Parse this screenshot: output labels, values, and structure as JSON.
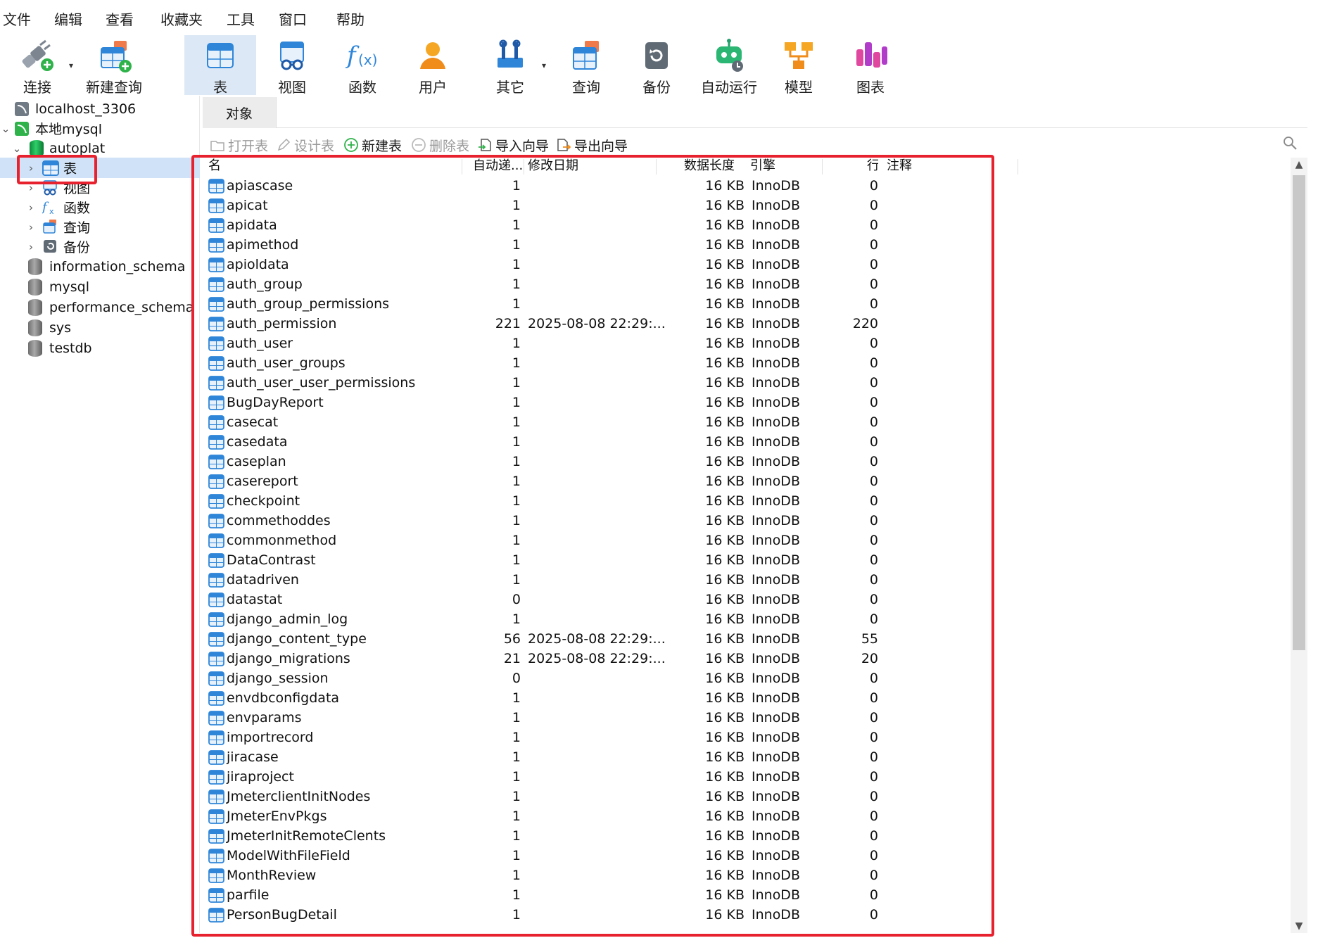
{
  "menu": [
    "文件",
    "编辑",
    "查看",
    "收藏夹",
    "工具",
    "窗口",
    "帮助"
  ],
  "toolbar": {
    "connect": "连接",
    "new_query": "新建查询",
    "table": "表",
    "view": "视图",
    "function": "函数",
    "user": "用户",
    "other": "其它",
    "query": "查询",
    "backup": "备份",
    "auto_run": "自动运行",
    "model": "模型",
    "chart": "图表",
    "dropdown_glyph": "▾"
  },
  "tree": {
    "connection": "localhost_3306",
    "local_mysql": "本地mysql",
    "db_autoplat": "autoplat",
    "node_table": "表",
    "node_view": "视图",
    "node_function": "函数",
    "node_query": "查询",
    "node_backup": "备份",
    "db_information_schema": "information_schema",
    "db_mysql": "mysql",
    "db_performance_schema": "performance_schema",
    "db_sys": "sys",
    "db_testdb": "testdb"
  },
  "objects_tab": "对象",
  "object_toolbar": {
    "open_table": "打开表",
    "design_table": "设计表",
    "new_table": "新建表",
    "delete_table": "删除表",
    "import_wizard": "导入向导",
    "export_wizard": "导出向导"
  },
  "columns": {
    "name": "名",
    "auto_increment": "自动递...",
    "modified": "修改日期",
    "data_length": "数据长度",
    "engine": "引擎",
    "rows": "行",
    "comment": "注释"
  },
  "rows": [
    {
      "name": "apiascase",
      "auto": "1",
      "modified": "",
      "size": "16 KB",
      "engine": "InnoDB",
      "rows": "0"
    },
    {
      "name": "apicat",
      "auto": "1",
      "modified": "",
      "size": "16 KB",
      "engine": "InnoDB",
      "rows": "0"
    },
    {
      "name": "apidata",
      "auto": "1",
      "modified": "",
      "size": "16 KB",
      "engine": "InnoDB",
      "rows": "0"
    },
    {
      "name": "apimethod",
      "auto": "1",
      "modified": "",
      "size": "16 KB",
      "engine": "InnoDB",
      "rows": "0"
    },
    {
      "name": "apioldata",
      "auto": "1",
      "modified": "",
      "size": "16 KB",
      "engine": "InnoDB",
      "rows": "0"
    },
    {
      "name": "auth_group",
      "auto": "1",
      "modified": "",
      "size": "16 KB",
      "engine": "InnoDB",
      "rows": "0"
    },
    {
      "name": "auth_group_permissions",
      "auto": "1",
      "modified": "",
      "size": "16 KB",
      "engine": "InnoDB",
      "rows": "0"
    },
    {
      "name": "auth_permission",
      "auto": "221",
      "modified": "2025-08-08 22:29:...",
      "size": "16 KB",
      "engine": "InnoDB",
      "rows": "220"
    },
    {
      "name": "auth_user",
      "auto": "1",
      "modified": "",
      "size": "16 KB",
      "engine": "InnoDB",
      "rows": "0"
    },
    {
      "name": "auth_user_groups",
      "auto": "1",
      "modified": "",
      "size": "16 KB",
      "engine": "InnoDB",
      "rows": "0"
    },
    {
      "name": "auth_user_user_permissions",
      "auto": "1",
      "modified": "",
      "size": "16 KB",
      "engine": "InnoDB",
      "rows": "0"
    },
    {
      "name": "BugDayReport",
      "auto": "1",
      "modified": "",
      "size": "16 KB",
      "engine": "InnoDB",
      "rows": "0"
    },
    {
      "name": "casecat",
      "auto": "1",
      "modified": "",
      "size": "16 KB",
      "engine": "InnoDB",
      "rows": "0"
    },
    {
      "name": "casedata",
      "auto": "1",
      "modified": "",
      "size": "16 KB",
      "engine": "InnoDB",
      "rows": "0"
    },
    {
      "name": "caseplan",
      "auto": "1",
      "modified": "",
      "size": "16 KB",
      "engine": "InnoDB",
      "rows": "0"
    },
    {
      "name": "casereport",
      "auto": "1",
      "modified": "",
      "size": "16 KB",
      "engine": "InnoDB",
      "rows": "0"
    },
    {
      "name": "checkpoint",
      "auto": "1",
      "modified": "",
      "size": "16 KB",
      "engine": "InnoDB",
      "rows": "0"
    },
    {
      "name": "commethoddes",
      "auto": "1",
      "modified": "",
      "size": "16 KB",
      "engine": "InnoDB",
      "rows": "0"
    },
    {
      "name": "commonmethod",
      "auto": "1",
      "modified": "",
      "size": "16 KB",
      "engine": "InnoDB",
      "rows": "0"
    },
    {
      "name": "DataContrast",
      "auto": "1",
      "modified": "",
      "size": "16 KB",
      "engine": "InnoDB",
      "rows": "0"
    },
    {
      "name": "datadriven",
      "auto": "1",
      "modified": "",
      "size": "16 KB",
      "engine": "InnoDB",
      "rows": "0"
    },
    {
      "name": "datastat",
      "auto": "0",
      "modified": "",
      "size": "16 KB",
      "engine": "InnoDB",
      "rows": "0"
    },
    {
      "name": "django_admin_log",
      "auto": "1",
      "modified": "",
      "size": "16 KB",
      "engine": "InnoDB",
      "rows": "0"
    },
    {
      "name": "django_content_type",
      "auto": "56",
      "modified": "2025-08-08 22:29:...",
      "size": "16 KB",
      "engine": "InnoDB",
      "rows": "55"
    },
    {
      "name": "django_migrations",
      "auto": "21",
      "modified": "2025-08-08 22:29:...",
      "size": "16 KB",
      "engine": "InnoDB",
      "rows": "20"
    },
    {
      "name": "django_session",
      "auto": "0",
      "modified": "",
      "size": "16 KB",
      "engine": "InnoDB",
      "rows": "0"
    },
    {
      "name": "envdbconfigdata",
      "auto": "1",
      "modified": "",
      "size": "16 KB",
      "engine": "InnoDB",
      "rows": "0"
    },
    {
      "name": "envparams",
      "auto": "1",
      "modified": "",
      "size": "16 KB",
      "engine": "InnoDB",
      "rows": "0"
    },
    {
      "name": "importrecord",
      "auto": "1",
      "modified": "",
      "size": "16 KB",
      "engine": "InnoDB",
      "rows": "0"
    },
    {
      "name": "jiracase",
      "auto": "1",
      "modified": "",
      "size": "16 KB",
      "engine": "InnoDB",
      "rows": "0"
    },
    {
      "name": "jiraproject",
      "auto": "1",
      "modified": "",
      "size": "16 KB",
      "engine": "InnoDB",
      "rows": "0"
    },
    {
      "name": "JmeterclientInitNodes",
      "auto": "1",
      "modified": "",
      "size": "16 KB",
      "engine": "InnoDB",
      "rows": "0"
    },
    {
      "name": "JmeterEnvPkgs",
      "auto": "1",
      "modified": "",
      "size": "16 KB",
      "engine": "InnoDB",
      "rows": "0"
    },
    {
      "name": "JmeterInitRemoteClents",
      "auto": "1",
      "modified": "",
      "size": "16 KB",
      "engine": "InnoDB",
      "rows": "0"
    },
    {
      "name": "ModelWithFileField",
      "auto": "1",
      "modified": "",
      "size": "16 KB",
      "engine": "InnoDB",
      "rows": "0"
    },
    {
      "name": "MonthReview",
      "auto": "1",
      "modified": "",
      "size": "16 KB",
      "engine": "InnoDB",
      "rows": "0"
    },
    {
      "name": "parfile",
      "auto": "1",
      "modified": "",
      "size": "16 KB",
      "engine": "InnoDB",
      "rows": "0"
    },
    {
      "name": "PersonBugDetail",
      "auto": "1",
      "modified": "",
      "size": "16 KB",
      "engine": "InnoDB",
      "rows": "0"
    }
  ],
  "scrollbar": {
    "up": "▲",
    "down": "▼"
  },
  "colors": {
    "accent": "#2f86d9",
    "selection": "#cfe2f7",
    "highlight_box": "#e8212e",
    "toolbar_active": "#dce8f5"
  }
}
